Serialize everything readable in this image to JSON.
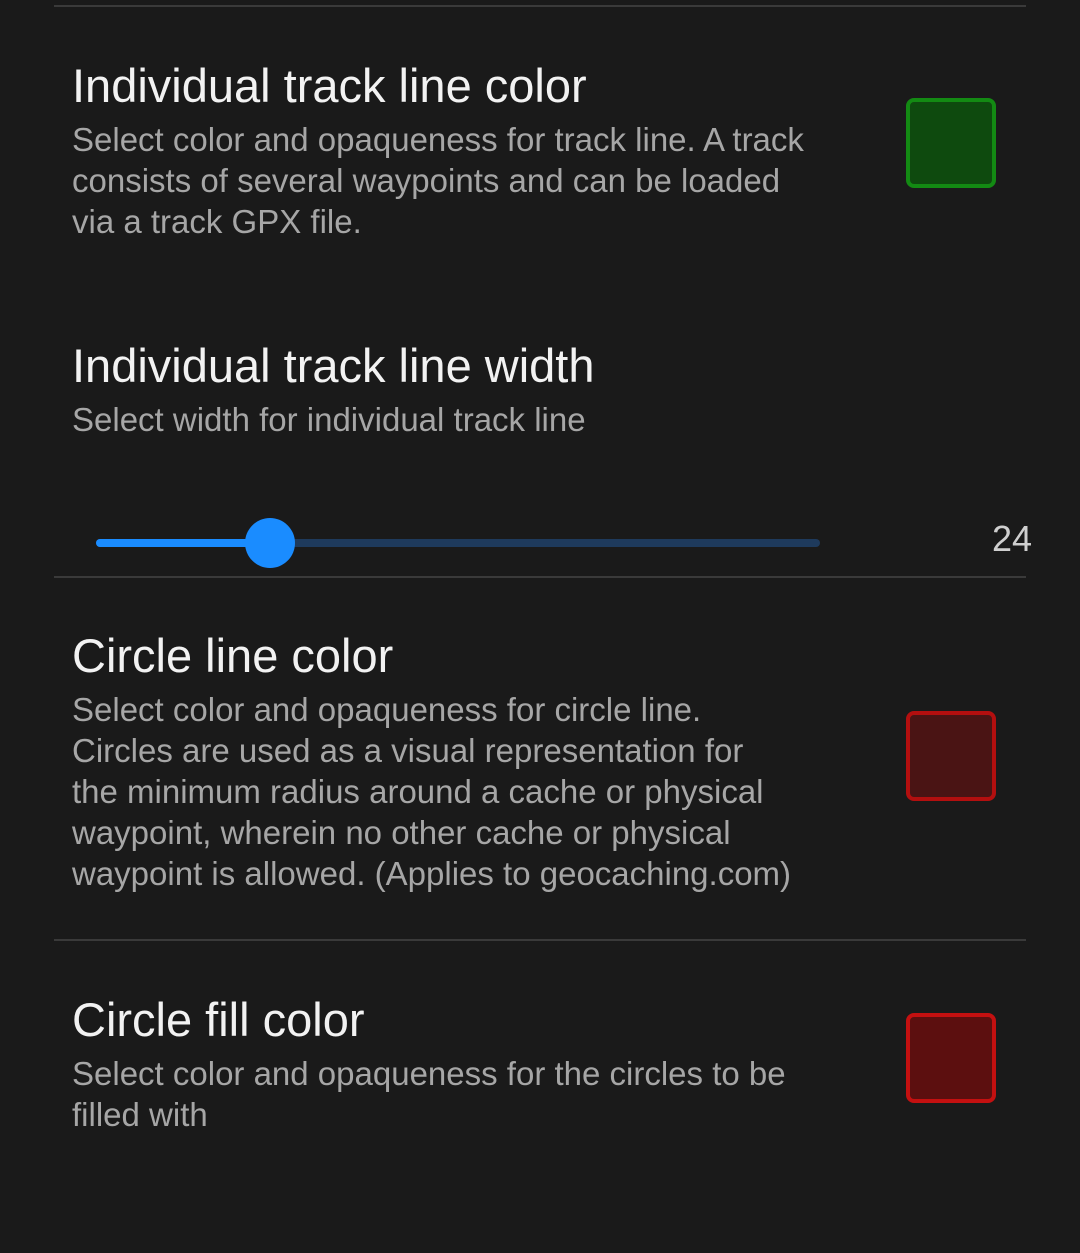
{
  "preferences": {
    "track_color": {
      "title": "Individual track line color",
      "summary": "Select color and opaqueness for track line. A track\nconsists of several waypoints and can be loaded\nvia a track GPX file.",
      "swatch_fill": "#0e4a0e",
      "swatch_border": "#138a13"
    },
    "track_width": {
      "title": "Individual track line width",
      "summary": "Select width for individual track line",
      "value": "24",
      "fraction": 0.24,
      "accent": "#1a8cff"
    },
    "circle_line_color": {
      "title": "Circle line color",
      "summary": "Select color and opaqueness for circle line.\nCircles are used as a visual representation for\nthe minimum radius around a cache or physical\nwaypoint, wherein no other cache or physical\nwaypoint is allowed. (Applies to geocaching.com)",
      "swatch_fill": "#4a1414",
      "swatch_border": "#b30f0f"
    },
    "circle_fill_color": {
      "title": "Circle fill color",
      "summary": "Select color and opaqueness for the circles to be\nfilled with",
      "swatch_fill": "#5c0f0f",
      "swatch_border": "#c41010"
    }
  }
}
